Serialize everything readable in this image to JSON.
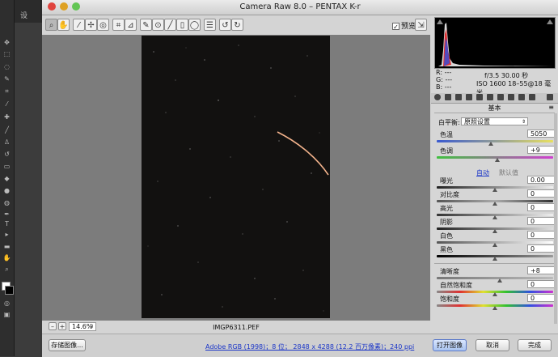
{
  "window": {
    "title": "Camera Raw 8.0 –  PENTAX K-r"
  },
  "toolbar": {
    "preview_label": "预览"
  },
  "photoshop": {
    "workspace_label": "设"
  },
  "readout": {
    "r_label": "R:",
    "g_label": "G:",
    "b_label": "B:",
    "r_val": "---",
    "g_val": "---",
    "b_val": "---",
    "aperture_shutter": "f/3.5   30.00 秒",
    "iso_lens": "ISO 1600    18–55@18 毫米"
  },
  "panel": {
    "title": "基本",
    "white_balance_label": "白平衡:",
    "white_balance_value": "原照设置",
    "temperature_label": "色温",
    "temperature_value": "5050",
    "tint_label": "色调",
    "tint_value": "+9",
    "auto_label": "自动",
    "default_label": "默认值",
    "exposure_label": "曝光",
    "exposure_value": "0.00",
    "contrast_label": "对比度",
    "contrast_value": "0",
    "highlights_label": "高光",
    "highlights_value": "0",
    "shadows_label": "阴影",
    "shadows_value": "0",
    "whites_label": "白色",
    "whites_value": "0",
    "blacks_label": "黑色",
    "blacks_value": "0",
    "clarity_label": "清晰度",
    "clarity_value": "+8",
    "vibrance_label": "自然饱和度",
    "vibrance_value": "0",
    "saturation_label": "饱和度",
    "saturation_value": "0"
  },
  "bottom": {
    "zoom_minus": "–",
    "zoom_plus": "+",
    "zoom": "14.6%",
    "filename": "IMGP6311.PEF"
  },
  "footer": {
    "save_label": "存储图像...",
    "workflow_info": "Adobe RGB (1998)；8 位；  2848 x 4288 (12.2 百万像素)；240 ppi",
    "open_label": "打开图像",
    "cancel_label": "取消",
    "done_label": "完成"
  },
  "colors": {
    "accent": "#1b36c8",
    "close": "#e0443e",
    "minimize": "#dea123",
    "zoom": "#62c554",
    "star_trail": "#f3b38c"
  }
}
